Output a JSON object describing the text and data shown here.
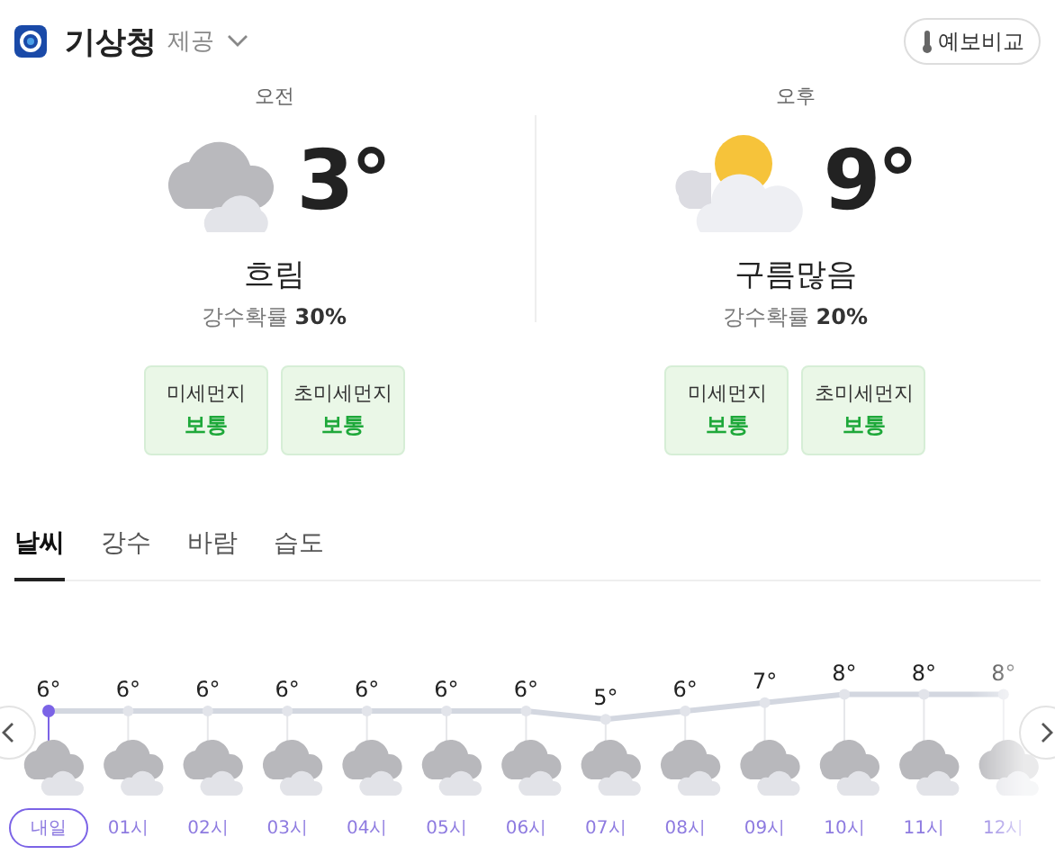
{
  "provider": {
    "name": "기상청",
    "suffix": "제공"
  },
  "compare_button": "예보비교",
  "periods": [
    {
      "label": "오전",
      "temp": "3°",
      "kind": "cloudy",
      "condition": "흐림",
      "precip_label": "강수확률",
      "precip_value": "30%",
      "dust": [
        {
          "label": "미세먼지",
          "grade": "보통"
        },
        {
          "label": "초미세먼지",
          "grade": "보통"
        }
      ]
    },
    {
      "label": "오후",
      "temp": "9°",
      "kind": "partly_cloudy",
      "condition": "구름많음",
      "precip_label": "강수확률",
      "precip_value": "20%",
      "dust": [
        {
          "label": "미세먼지",
          "grade": "보통"
        },
        {
          "label": "초미세먼지",
          "grade": "보통"
        }
      ]
    }
  ],
  "tabs": [
    {
      "label": "날씨",
      "selected": true
    },
    {
      "label": "강수",
      "selected": false
    },
    {
      "label": "바람",
      "selected": false
    },
    {
      "label": "습도",
      "selected": false
    }
  ],
  "hourly": {
    "chart_data": {
      "type": "line",
      "categories": [
        "내일",
        "01시",
        "02시",
        "03시",
        "04시",
        "05시",
        "06시",
        "07시",
        "08시",
        "09시",
        "10시",
        "11시",
        "12시"
      ],
      "series": [
        {
          "color": "#d3d7e0",
          "marker": true,
          "values": [
            6,
            6,
            6,
            6,
            6,
            6,
            6,
            5,
            6,
            7,
            8,
            8,
            8
          ],
          "value_labels": [
            "6°",
            "6°",
            "6°",
            "6°",
            "6°",
            "6°",
            "6°",
            "5°",
            "6°",
            "7°",
            "8°",
            "8°",
            "8°"
          ]
        }
      ],
      "grid": true,
      "data_labels": true
    },
    "hours": [
      {
        "selected": true
      },
      {
        "selected": false
      },
      {
        "selected": false
      },
      {
        "selected": false
      },
      {
        "selected": false
      },
      {
        "selected": false
      },
      {
        "selected": false
      },
      {
        "selected": false
      },
      {
        "selected": false
      },
      {
        "selected": false
      },
      {
        "selected": false
      },
      {
        "selected": false
      },
      {
        "selected": false
      }
    ]
  }
}
